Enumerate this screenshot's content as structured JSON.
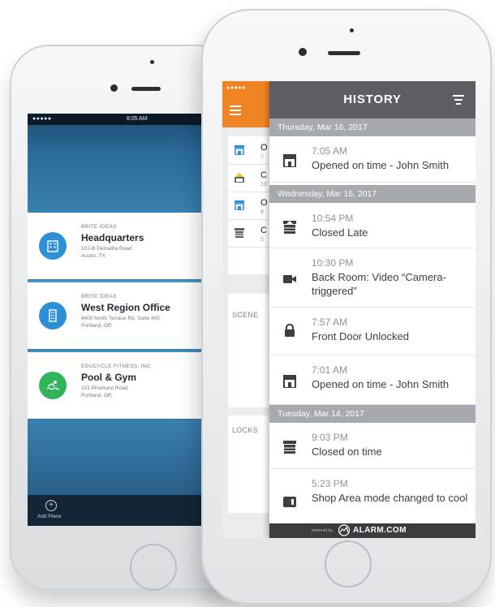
{
  "colors": {
    "accent_orange": "#f08424",
    "header_gray": "#5b5e62",
    "date_bar_gray": "#a6a9ad",
    "site_blue": "#2d8fd6",
    "site_green": "#31b35a"
  },
  "back_phone": {
    "status": {
      "signal": "●●●●● ",
      "time": "8:05 AM"
    },
    "sites": [
      {
        "company": "BRITE IDEAS",
        "name": "Headquarters",
        "address_line1": "102-B Demalha Road",
        "address_line2": "Austin, TX",
        "icon": "office-building-icon",
        "color": "#2d8fd6"
      },
      {
        "company": "BRITE IDEAS",
        "name": "West Region Office",
        "address_line1": "4400 North Terrace Rd, Suite 400",
        "address_line2": "Portland, OR",
        "icon": "office-tower-icon",
        "color": "#2d8fd6"
      },
      {
        "company": "EDUCYCLE FITNESS, INC",
        "name": "Pool & Gym",
        "address_line1": "101 Pinehurst Road",
        "address_line2": "Portland, OR",
        "icon": "swimmer-icon",
        "color": "#31b35a"
      }
    ],
    "add_label": "Add Place"
  },
  "front_phone": {
    "status": {
      "signal": "●●●●● "
    },
    "under_rows": [
      {
        "title": "O",
        "sub": "7",
        "icon": "storefront-icon"
      },
      {
        "title": "C",
        "sub": "10",
        "icon": "warning-storefront-icon"
      },
      {
        "title": "O",
        "sub": "8",
        "icon": "storefront-icon"
      },
      {
        "title": "C",
        "sub": "5",
        "icon": "closed-storefront-icon"
      }
    ],
    "under_sections": {
      "scenes": "SCENE",
      "locks": "LOCKS"
    },
    "history": {
      "title": "HISTORY",
      "groups": [
        {
          "date": "Thursday, Mar 16, 2017",
          "events": [
            {
              "time": "7:05 AM",
              "text": "Opened on time - John Smith",
              "icon": "storefront-icon"
            }
          ]
        },
        {
          "date": "Wednesday, Mar 15, 2017",
          "events": [
            {
              "time": "10:54 PM",
              "text": "Closed Late",
              "icon": "late-storefront-icon"
            },
            {
              "time": "10:30 PM",
              "text": "Back Room: Video “Camera-triggered”",
              "icon": "video-camera-icon"
            },
            {
              "time": "7:57 AM",
              "text": "Front Door Unlocked",
              "icon": "lock-icon"
            },
            {
              "time": "7:01 AM",
              "text": "Opened on time - John Smith",
              "icon": "storefront-icon"
            }
          ]
        },
        {
          "date": "Tuesday, Mar 14, 2017",
          "events": [
            {
              "time": "9:03 PM",
              "text": "Closed on time",
              "icon": "closed-storefront-icon"
            },
            {
              "time": "5:23 PM",
              "text": "Shop Area mode changed to cool",
              "icon": "thermostat-icon"
            }
          ]
        }
      ]
    },
    "footer": {
      "powered_by": "powered by",
      "brand": "ALARM.COM"
    }
  }
}
